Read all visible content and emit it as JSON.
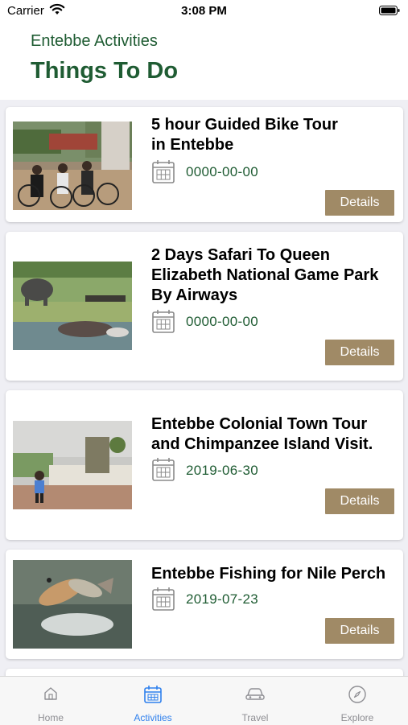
{
  "status": {
    "carrier": "Carrier",
    "time": "3:08 PM"
  },
  "header": {
    "subtitle": "Entebbe Activities",
    "title": "Things To Do"
  },
  "activities": [
    {
      "title": "5 hour Guided Bike Tour\nin Entebbe",
      "date": "0000-00-00",
      "button": "Details",
      "image": "bike-tour-photo"
    },
    {
      "title": "2 Days Safari To Queen\nElizabeth National Game Park\nBy Airways",
      "date": "0000-00-00",
      "button": "Details",
      "image": "safari-photo"
    },
    {
      "title": "Entebbe Colonial Town Tour\nand Chimpanzee Island Visit.",
      "date": "2019-06-30",
      "button": "Details",
      "image": "colonial-tour-photo"
    },
    {
      "title": "Entebbe Fishing for Nile Perch",
      "date": "2019-07-23",
      "button": "Details",
      "image": "fishing-photo"
    }
  ],
  "tabs": [
    {
      "label": "Home",
      "icon": "home-icon",
      "active": false
    },
    {
      "label": "Activities",
      "icon": "calendar-icon",
      "active": true
    },
    {
      "label": "Travel",
      "icon": "car-icon",
      "active": false
    },
    {
      "label": "Explore",
      "icon": "compass-icon",
      "active": false
    }
  ],
  "colors": {
    "accent": "#1f5c33",
    "button": "#a08a66",
    "active_tab": "#2f80ed",
    "inactive_tab": "#8e8e93"
  }
}
